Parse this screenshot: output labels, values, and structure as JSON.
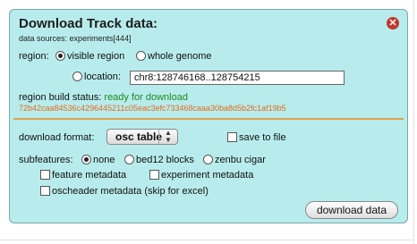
{
  "dialog": {
    "title": "Download Track data:",
    "data_sources": "data sources: experiments[444]"
  },
  "region": {
    "label": "region:",
    "option_visible": "visible region",
    "option_whole": "whole genome",
    "option_location": "location:",
    "location_value": "chr8:128746168..128754215",
    "selected": "visible region"
  },
  "build_status": {
    "label": "region build status:",
    "status": "ready for download",
    "hash": "72b42caa84536c4296445211c05eac3efc733468caaa30ba8d5b2fc1af19b5"
  },
  "format": {
    "label": "download format:",
    "selected": "osc table",
    "save_to_file": "save to file"
  },
  "subfeatures": {
    "label": "subfeatures:",
    "option_none": "none",
    "option_bed12": "bed12 blocks",
    "option_zenbu": "zenbu cigar",
    "selected": "none",
    "feature_metadata": "feature metadata",
    "experiment_metadata": "experiment metadata",
    "oscheader_metadata": "oscheader metadata (skip for excel)"
  },
  "actions": {
    "download": "download data"
  }
}
